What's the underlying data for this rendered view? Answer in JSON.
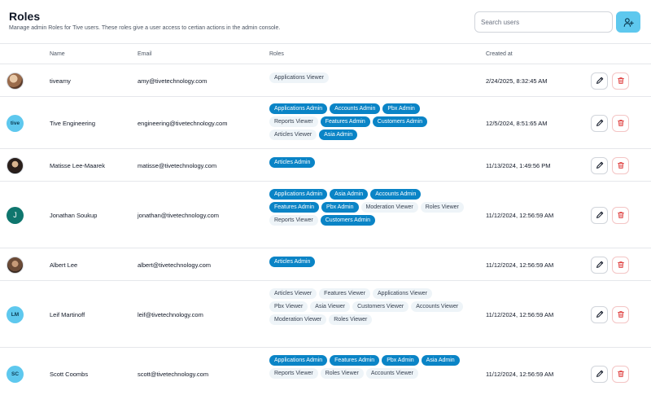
{
  "header": {
    "title": "Roles",
    "subtitle": "Manage admin Roles for Tive users. These roles give a user access to certian actions in the admin console.",
    "search_placeholder": "Search users"
  },
  "colors": {
    "accent": "#5ec8ee",
    "admin_chip": "#0a84c6",
    "viewer_chip": "#eef4f8",
    "delete": "#e04848"
  },
  "table": {
    "columns": [
      "Name",
      "Email",
      "Roles",
      "Created at"
    ],
    "rows": [
      {
        "avatar": "photo",
        "name": "tiveamy",
        "email": "amy@tivetechnology.com",
        "created": "2/24/2025, 8:32:45 AM",
        "roles": [
          {
            "label": "Applications Viewer",
            "kind": "viewer"
          }
        ]
      },
      {
        "avatar": "tive",
        "name": "Tive Engineering",
        "email": "engineering@tivetechnology.com",
        "created": "12/5/2024, 8:51:65 AM",
        "roles": [
          {
            "label": "Applications Admin",
            "kind": "admin"
          },
          {
            "label": "Accounts Admin",
            "kind": "admin"
          },
          {
            "label": "Pbx Admin",
            "kind": "admin"
          },
          {
            "label": "Reports Viewer",
            "kind": "viewer"
          },
          {
            "label": "Features Admin",
            "kind": "admin"
          },
          {
            "label": "Customers Admin",
            "kind": "admin"
          },
          {
            "label": "Articles Viewer",
            "kind": "viewer"
          },
          {
            "label": "Asia Admin",
            "kind": "admin"
          }
        ]
      },
      {
        "avatar": "photo",
        "name": "Matisse Lee-Maarek",
        "email": "matisse@tivetechnology.com",
        "created": "11/13/2024, 1:49:56 PM",
        "roles": [
          {
            "label": "Articles Admin",
            "kind": "admin"
          }
        ]
      },
      {
        "avatar": "J",
        "name": "Jonathan Soukup",
        "email": "jonathan@tivetechnology.com",
        "created": "11/12/2024, 12:56:59 AM",
        "roles": [
          {
            "label": "Applications Admin",
            "kind": "admin"
          },
          {
            "label": "Asia Admin",
            "kind": "admin"
          },
          {
            "label": "Accounts Admin",
            "kind": "admin"
          },
          {
            "label": "Features Admin",
            "kind": "admin"
          },
          {
            "label": "Pbx Admin",
            "kind": "admin"
          },
          {
            "label": "Moderation Viewer",
            "kind": "viewer"
          },
          {
            "label": "Roles Viewer",
            "kind": "viewer"
          },
          {
            "label": "Reports Viewer",
            "kind": "viewer"
          },
          {
            "label": "Customers Admin",
            "kind": "admin"
          }
        ]
      },
      {
        "avatar": "photo",
        "name": "Albert Lee",
        "email": "albert@tivetechnology.com",
        "created": "11/12/2024, 12:56:59 AM",
        "roles": [
          {
            "label": "Articles Admin",
            "kind": "admin"
          }
        ]
      },
      {
        "avatar": "LM",
        "name": "Leif Martinoff",
        "email": "leif@tivetechnology.com",
        "created": "11/12/2024, 12:56:59 AM",
        "roles": [
          {
            "label": "Articles Viewer",
            "kind": "viewer"
          },
          {
            "label": "Features Viewer",
            "kind": "viewer"
          },
          {
            "label": "Applications Viewer",
            "kind": "viewer"
          },
          {
            "label": "Pbx Viewer",
            "kind": "viewer"
          },
          {
            "label": "Asia Viewer",
            "kind": "viewer"
          },
          {
            "label": "Customers Viewer",
            "kind": "viewer"
          },
          {
            "label": "Accounts Viewer",
            "kind": "viewer"
          },
          {
            "label": "Moderation Viewer",
            "kind": "viewer"
          },
          {
            "label": "Roles Viewer",
            "kind": "viewer"
          }
        ]
      },
      {
        "avatar": "SC",
        "name": "Scott Coombs",
        "email": "scott@tivetechnology.com",
        "created": "11/12/2024, 12:56:59 AM",
        "roles": [
          {
            "label": "Applications Admin",
            "kind": "admin"
          },
          {
            "label": "Features Admin",
            "kind": "admin"
          },
          {
            "label": "Pbx Admin",
            "kind": "admin"
          },
          {
            "label": "Asia Admin",
            "kind": "admin"
          },
          {
            "label": "Reports Viewer",
            "kind": "viewer"
          },
          {
            "label": "Roles Viewer",
            "kind": "viewer"
          },
          {
            "label": "Accounts Viewer",
            "kind": "viewer"
          }
        ]
      }
    ]
  }
}
